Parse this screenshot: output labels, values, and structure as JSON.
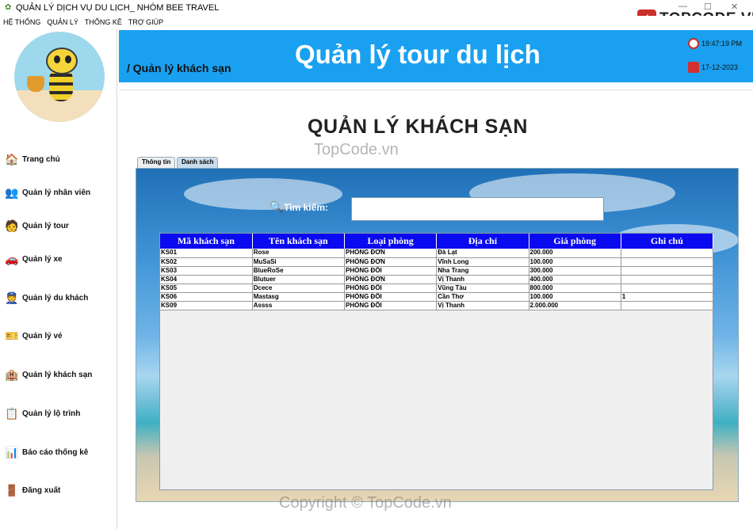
{
  "window": {
    "title": "QUẢN LÝ DỊCH VỤ DU LỊCH_ NHÓM BEE TRAVEL",
    "brand": "TOPCODE.VN"
  },
  "menu": [
    "HỆ THỐNG",
    "QUẢN LÝ",
    "THỐNG KÊ",
    "TRỢ GIÚP"
  ],
  "sidebar": {
    "items": [
      {
        "label": "Trang chủ",
        "icon": "home-icon"
      },
      {
        "label": "Quản lý nhân viên",
        "icon": "staff-icon"
      },
      {
        "label": "Quản lý tour",
        "icon": "tour-guide-icon"
      },
      {
        "label": "Quản lý xe",
        "icon": "car-icon"
      },
      {
        "label": "Quản lý du khách",
        "icon": "traveler-icon"
      },
      {
        "label": "Quản lý vé",
        "icon": "ticket-icon"
      },
      {
        "label": "Quản lý khách sạn",
        "icon": "hotel-icon"
      },
      {
        "label": "Quản lý lộ trình",
        "icon": "itinerary-icon"
      },
      {
        "label": "Báo cáo thống kê",
        "icon": "report-icon"
      },
      {
        "label": "Đăng xuất",
        "icon": "logout-door-icon"
      }
    ]
  },
  "header": {
    "breadcrumb": "/  Quản lý khách sạn",
    "title": "Quản lý tour du lịch",
    "time": "19:47:19 PM",
    "date": "17-12-2023",
    "color": "#1aa0f0"
  },
  "page": {
    "heading": "QUẢN LÝ KHÁCH SẠN",
    "watermark_top": "TopCode.vn",
    "watermark_bottom": "Copyright © TopCode.vn"
  },
  "tabs": [
    {
      "label": "Thông tin",
      "active": false
    },
    {
      "label": "Danh sách",
      "active": true
    }
  ],
  "search": {
    "label": "Tìm kiếm:",
    "value": ""
  },
  "table": {
    "columns": [
      "Mã khách sạn",
      "Tên khách sạn",
      "Loại phòng",
      "Địa chỉ",
      "Giá phòng",
      "Ghi chú"
    ],
    "rows": [
      [
        "KS01",
        "Rose",
        "PHÒNG ĐƠN",
        "Đà Lạt",
        "200.000",
        ""
      ],
      [
        "KS02",
        "MuSaSi",
        "PHÒNG ĐƠN",
        "Vĩnh Long",
        "100.000",
        ""
      ],
      [
        "KS03",
        "BlueRoSe",
        "PHÒNG ĐÔI",
        "Nha Trang",
        "300.000",
        ""
      ],
      [
        "KS04",
        "Blutuer",
        "PHÒNG ĐƠN",
        "Vị Thanh",
        "400.000",
        ""
      ],
      [
        "KS05",
        "Dcece",
        "PHÒNG ĐÔI",
        "Vũng Tàu",
        "800.000",
        ""
      ],
      [
        "KS06",
        "Mastasg",
        "PHÒNG ĐÔI",
        "Cần Thơ",
        "100.000",
        "1"
      ],
      [
        "KS09",
        "Assss",
        "PHÒNG ĐÔI",
        "Vị Thanh",
        "2.000.000",
        ""
      ]
    ],
    "header_color": "#0a0af0"
  }
}
